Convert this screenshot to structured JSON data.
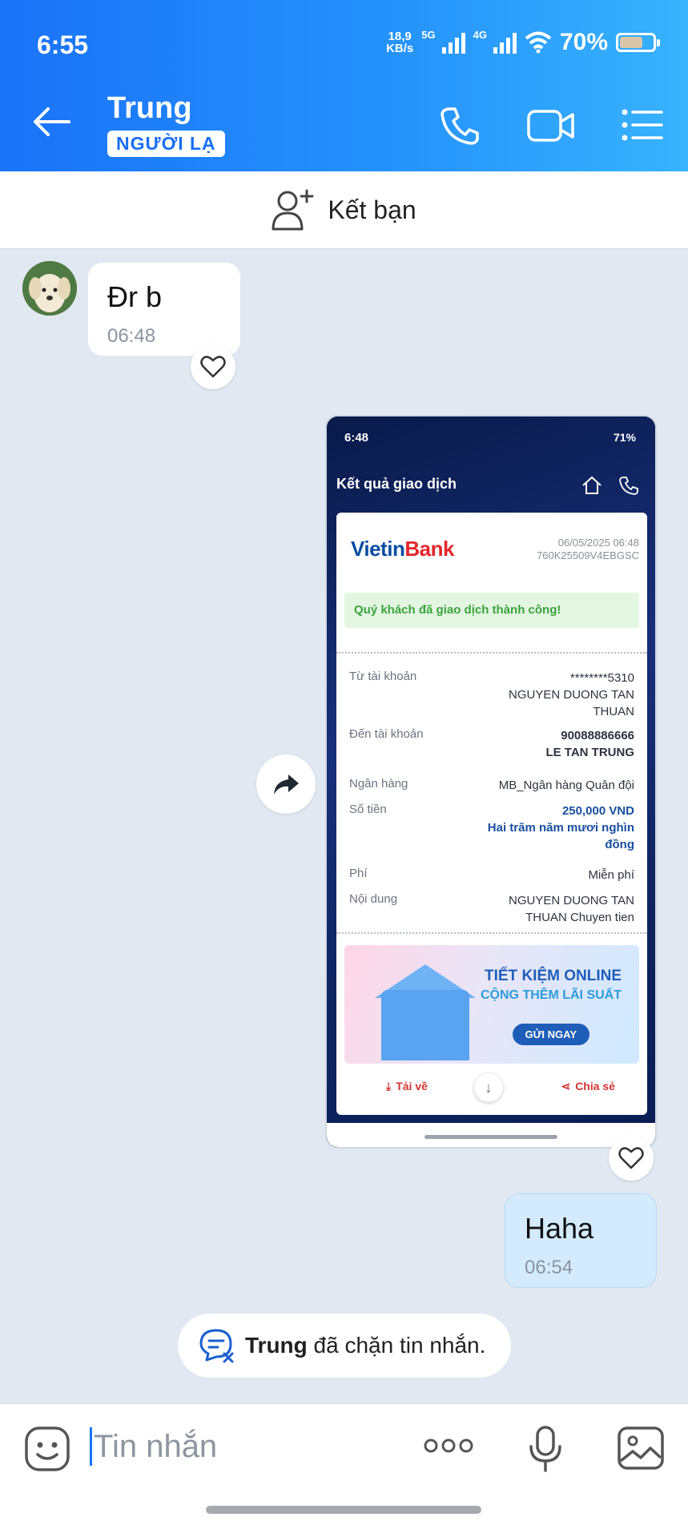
{
  "status_bar": {
    "time": "6:55",
    "net_speed_top": "18,9",
    "net_speed_bottom": "KB/s",
    "sim1": "5G",
    "sim2": "4G",
    "battery": "70%",
    "battery_level": 0.7
  },
  "header": {
    "contact_name": "Trung",
    "badge": "NGƯỜI LẠ",
    "accent_color": "#1a73f8"
  },
  "friend_bar": {
    "label": "Kết bạn"
  },
  "messages": {
    "incoming": {
      "text": "Đr b",
      "time": "06:48"
    },
    "outgoing": {
      "text": "Haha",
      "time": "06:54"
    }
  },
  "receipt": {
    "status_time": "6:48",
    "status_right": "71%",
    "title": "Kết quả giao dịch",
    "bank_name_a": "Vietin",
    "bank_name_b": "Bank",
    "datetime": "06/05/2025 06:48",
    "ref": "760K25509V4EBGSC",
    "success_msg": "Quý khách đã giao dịch thành công!",
    "from_label": "Từ tài khoản",
    "from_account": "********5310",
    "from_name": "NGUYEN DUONG TAN THUAN",
    "to_label": "Đến tài khoản",
    "to_account": "90088886666",
    "to_name": "LE TAN TRUNG",
    "bank_label": "Ngân hàng",
    "bank_value": "MB_Ngân hàng Quân đội",
    "amount_label": "Số tiền",
    "amount": "250,000 VND",
    "amount_words": "Hai trăm năm mươi nghìn đồng",
    "fee_label": "Phí",
    "fee_value": "Miễn phí",
    "content_label": "Nội dung",
    "content_value": "NGUYEN DUONG TAN THUAN Chuyen tien",
    "banner_title": "TIẾT KIỆM ONLINE",
    "banner_sub": "CỘNG THÊM LÃI SUẤT",
    "banner_btn": "GỬI NGAY",
    "download_label": "Tải về",
    "share_label": "Chia sẻ"
  },
  "block_notice": {
    "name": "Trung",
    "text": "đã chặn tin nhắn."
  },
  "input": {
    "placeholder": "Tin nhắn"
  }
}
